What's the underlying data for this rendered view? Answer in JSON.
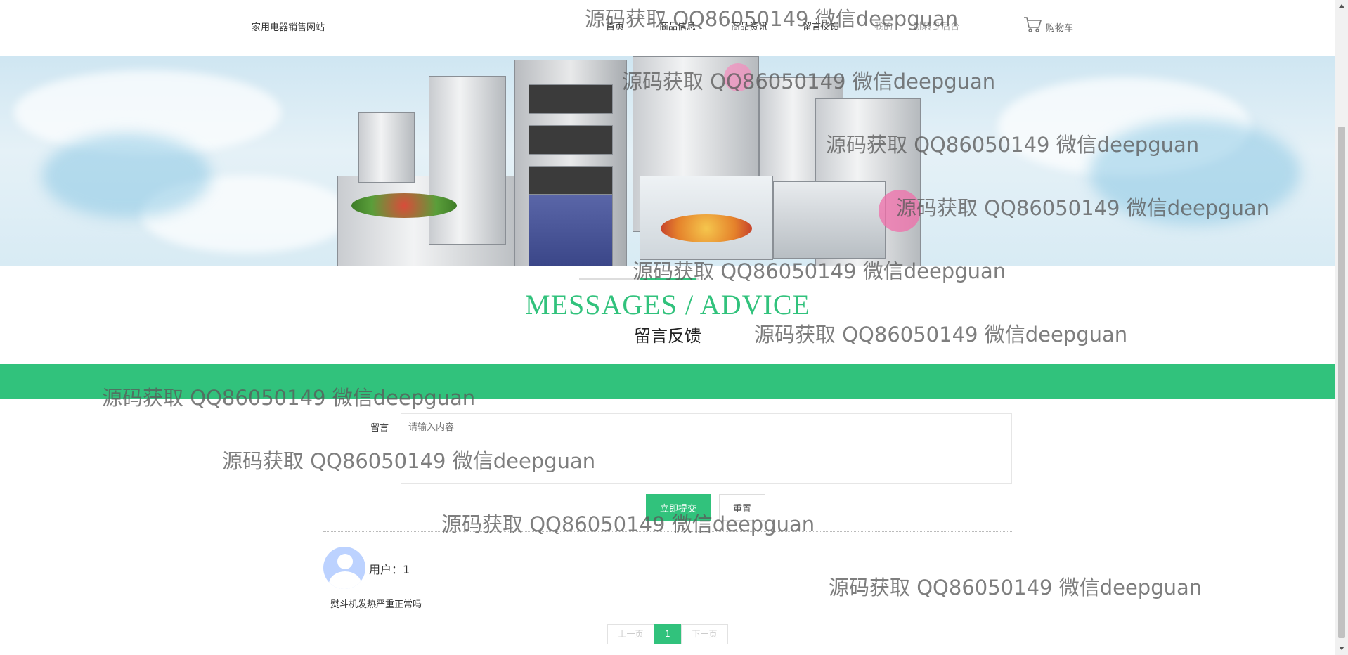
{
  "header": {
    "site_name": "家用电器销售网站",
    "nav": [
      "首页",
      "商品信息",
      "商品资讯",
      "留言反馈",
      "我的",
      "跳转到后台"
    ],
    "cart_label": "购物车"
  },
  "section": {
    "title_en": "MESSAGES / ADVICE",
    "title_cn": "留言反馈"
  },
  "form": {
    "label": "留言",
    "placeholder": "请输入内容",
    "submit_label": "立即提交",
    "reset_label": "重置"
  },
  "messages": [
    {
      "user": "用户：1",
      "content": "熨斗机发热严重正常吗"
    }
  ],
  "pagination": {
    "prev": "上一页",
    "current": "1",
    "next": "下一页"
  },
  "watermark": "源码获取 QQ86050149 微信deepguan",
  "colors": {
    "accent": "#31c27c",
    "avatar": "#bcd2ff"
  },
  "icons": {
    "cart": "shopping-cart-icon"
  }
}
